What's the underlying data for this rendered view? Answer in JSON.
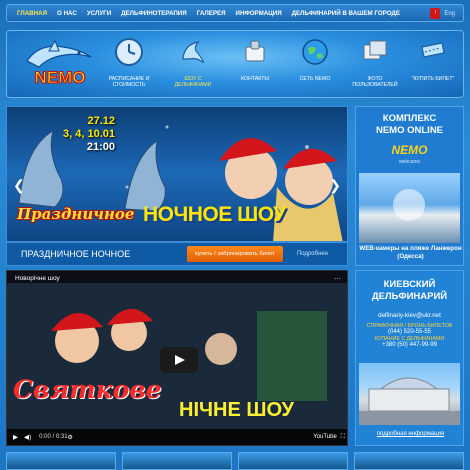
{
  "topnav": {
    "items": [
      "ГЛАВНАЯ",
      "О НАС",
      "УСЛУГИ",
      "ДЕЛЬФИНОТЕРАПИЯ",
      "ГАЛЕРЕЯ",
      "ИНФОРМАЦИЯ",
      "ДЕЛЬФИНАРИЙ В ВАШЕМ ГОРОДЕ"
    ],
    "lang_active": "!",
    "lang_eng": "Eng"
  },
  "header": {
    "logo_text": "NEMO",
    "nav": [
      {
        "label": "РАСПИСАНИЕ И СТОИМОСТЬ",
        "icon": "clock-icon"
      },
      {
        "label": "ШОУ С ДЕЛЬФИНАМИ",
        "icon": "dolphin-icon"
      },
      {
        "label": "КОНТАКТЫ",
        "icon": "phone-icon"
      },
      {
        "label": "СЕТЬ NEMO",
        "icon": "globe-icon"
      },
      {
        "label": "ФОТО ПОЛЬЗОВАТЕЛЕЙ",
        "icon": "photo-icon"
      },
      {
        "label": "\"КУПИТЬ БИЛЕТ\"",
        "icon": "ticket-icon"
      }
    ]
  },
  "slider": {
    "date_main": "27.12",
    "dates_2": "3, 4, 10.01",
    "time": "21:00",
    "script_title": "Праздничное",
    "main_title": "НОЧНОЕ ШОУ",
    "caption": "ПРАЗДНИЧНОЕ НОЧНОЕ",
    "buy_label": "купить / забронировать билет",
    "more_label": "Подробнее"
  },
  "right_top": {
    "title_line1": "КОМПЛЕКС",
    "title_line2": "NEMO ONLINE",
    "logo_text": "NEMO",
    "logo_sub": "webcams",
    "caption": "WEB-камеры на пляже Ланжерон (Одесса)"
  },
  "video": {
    "title": "Новорічне шоу",
    "time": "0:00 / 0:31",
    "watermark_script": "Святкове",
    "watermark_main": "НІЧНЕ ШОУ",
    "yt_label": "YouTube"
  },
  "right_bottom": {
    "title_line1": "КИЕВСКИЙ",
    "title_line2": "ДЕЛЬФИНАРИЙ",
    "email": "delfinariy-kiev@ukr.net",
    "booking_label": "СПРАВОЧНАЯ / БРОНЬ БИЛЕТОВ",
    "phone1": "(044) 520-55-55",
    "phone2_label": "КУПАНИЕ С ДЕЛЬФИНАМИ",
    "phone2": "+380 (50) 447-99-99",
    "more_label": "подробная информация"
  },
  "colors": {
    "accent": "#ffe44d",
    "buy_button": "#ff8a1c",
    "panel": "#1f7cd0"
  }
}
